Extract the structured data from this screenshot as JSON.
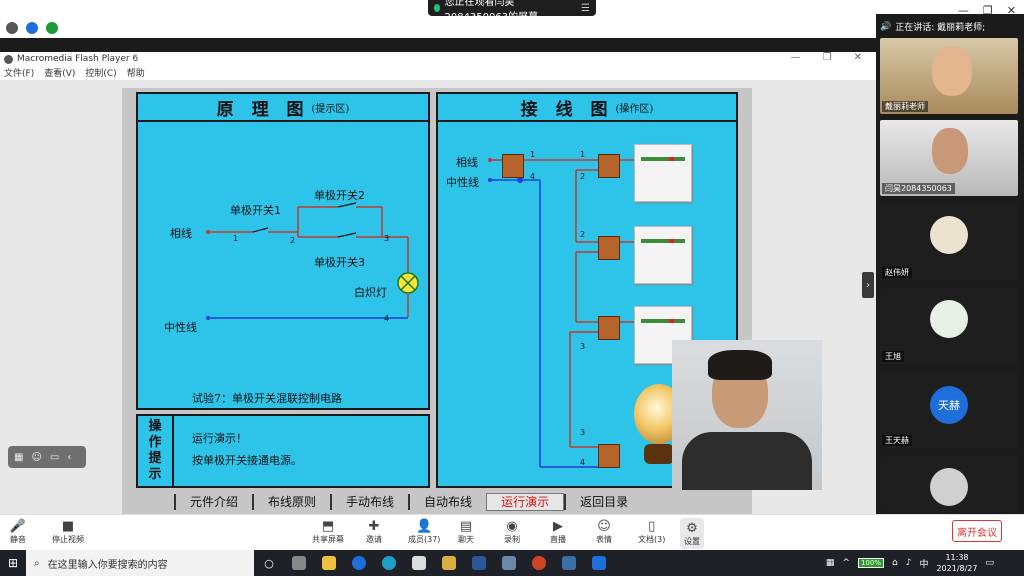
{
  "share_banner": {
    "text": "您正在观看闫昊2084350063的屏幕"
  },
  "flash": {
    "title": "Macromedia Flash Player 6",
    "menu": [
      "文件(F)",
      "查看(V)",
      "控制(C)",
      "帮助"
    ],
    "principle_panel": {
      "title": "原 理 图",
      "subtitle": "(提示区)",
      "labels": {
        "phase": "相线",
        "single_switch_1": "单极开关1",
        "single_switch_2": "单极开关2",
        "single_switch_3": "单极开关3",
        "lamp": "白炽灯",
        "neutral": "中性线"
      },
      "wire_numbers": [
        "1",
        "2",
        "3",
        "4"
      ],
      "experiment": "试验7：单极开关混联控制电路"
    },
    "wiring_panel": {
      "title": "接 线 图",
      "subtitle": "(操作区)",
      "labels": {
        "phase": "相线",
        "neutral": "中性线"
      },
      "wire_numbers": [
        "1",
        "4",
        "1",
        "2",
        "2",
        "3",
        "3",
        "4"
      ]
    },
    "ops": {
      "title_chars": [
        "操",
        "作",
        "提",
        "示"
      ],
      "lines": [
        "运行演示！",
        "按单极开关接通电源。"
      ]
    },
    "nav": {
      "tabs": [
        "元件介绍",
        "布线原则",
        "手动布线",
        "自动布线",
        "运行演示",
        "返回目录"
      ],
      "active": "运行演示"
    }
  },
  "sidebar": {
    "speaking_label": "正在讲话: 戴丽莉老师;",
    "participants": [
      {
        "name": "戴丽莉老师"
      },
      {
        "name": "闫昊2084350063"
      },
      {
        "name": "赵伟妍"
      },
      {
        "name": "王旭"
      },
      {
        "name": "王天赫",
        "avatar_text": "天赫"
      }
    ]
  },
  "controls": {
    "mute": "静音",
    "stop_video": "停止视频",
    "share": "共享屏幕",
    "invite": "邀请",
    "members": "成员(37)",
    "chat": "聊天",
    "record": "录制",
    "live": "直播",
    "reactions": "表情",
    "docs": "文档(3)",
    "settings": "设置",
    "leave": "离开会议"
  },
  "taskbar": {
    "search_placeholder": "在这里输入你要搜索的内容",
    "battery": "100%",
    "time": "11:38",
    "date": "2021/8/27"
  },
  "colors": {
    "panel_bg": "#2ec4ea",
    "wire_red": "#c0392b",
    "wire_blue": "#1f3fd6",
    "active_tab": "#dd1111"
  }
}
